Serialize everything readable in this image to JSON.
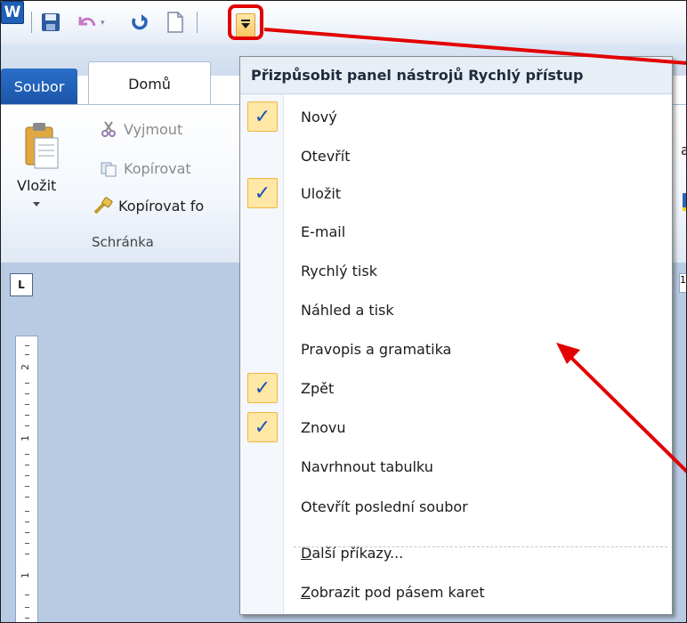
{
  "qat": {
    "app_icon_letter": "W",
    "icons": [
      "word-app-icon",
      "save-icon",
      "undo-icon",
      "redo-icon",
      "new-document-icon",
      "customize-toolbar-icon"
    ]
  },
  "ribbon": {
    "tab_file": "Soubor",
    "tab_home": "Domů",
    "paste_label": "Vložit",
    "cut_label": "Vyjmout",
    "copy_label": "Kopírovat",
    "format_painter_label": "Kopírovat fo",
    "group_label": "Schránka",
    "right_partial_letter": "a"
  },
  "doc": {
    "tab_selector": "L",
    "ruler_numbers": [
      "2",
      "1",
      "1"
    ],
    "h_ruler_partial": "1"
  },
  "menu": {
    "title": "Přizpůsobit panel nástrojů Rychlý přístup",
    "items": [
      {
        "label": "Nový",
        "checked": true
      },
      {
        "label": "Otevřít",
        "checked": false
      },
      {
        "label": "Uložit",
        "checked": true
      },
      {
        "label": "E-mail",
        "checked": false
      },
      {
        "label": "Rychlý tisk",
        "checked": false
      },
      {
        "label": "Náhled a tisk",
        "checked": false
      },
      {
        "label": "Pravopis a gramatika",
        "checked": false
      },
      {
        "label": "Zpět",
        "checked": true
      },
      {
        "label": "Znovu",
        "checked": true
      },
      {
        "label": "Navrhnout tabulku",
        "checked": false
      },
      {
        "label": "Otevřít poslední soubor",
        "checked": false
      }
    ],
    "more_commands_underline": "D",
    "more_commands_rest": "alší příkazy...",
    "show_below_underline": "Z",
    "show_below_rest": "obrazit pod pásem karet",
    "check_glyph": "✓"
  },
  "colors": {
    "annotation_red": "#e20000",
    "check_highlight": "#ffe7a6",
    "file_tab_blue": "#1b55a8"
  }
}
